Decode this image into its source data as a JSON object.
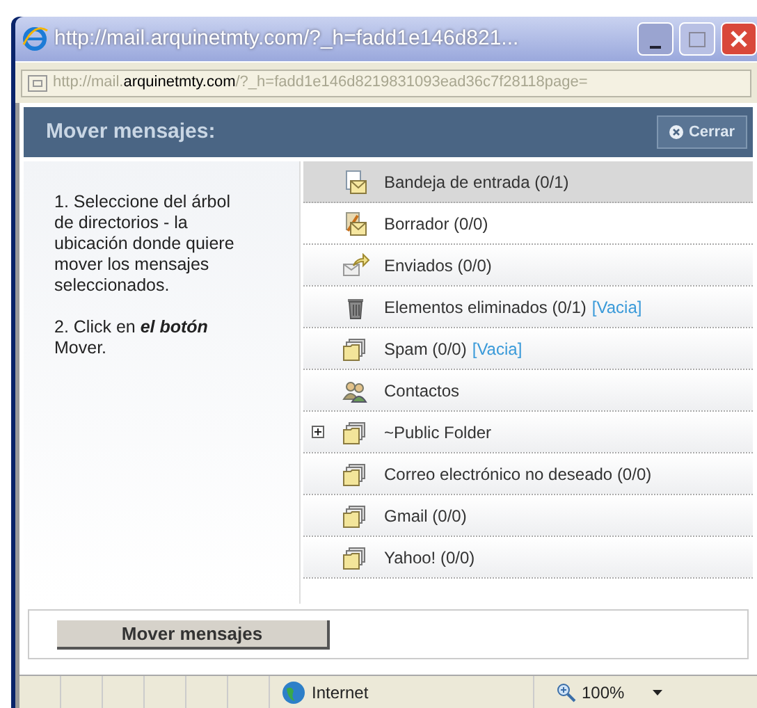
{
  "window": {
    "title": "http://mail.arquinetmty.com/?_h=fadd1e146d821..."
  },
  "address": {
    "prefix": "http://mail.",
    "domain": "arquinetmty.com",
    "suffix": "/?_h=fadd1e146d8219831093ead36c7f28118page="
  },
  "header": {
    "title": "Mover mensajes:",
    "close": "Cerrar"
  },
  "instructions": [
    "1. Seleccione del árbol de directorios - la ubicación donde quiere mover los mensajes seleccionados.",
    "2. Click en **el botón** Mover."
  ],
  "folders": [
    {
      "kind": "inbox",
      "label": "Bandeja de entrada (0/1)",
      "selected": true
    },
    {
      "kind": "drafts",
      "label": "Borrador (0/0)",
      "selected": false
    },
    {
      "kind": "sent",
      "label": "Enviados (0/0)",
      "selected": false
    },
    {
      "kind": "trash",
      "label": "Elementos eliminados (0/1)",
      "action": "[Vacia]",
      "selected": false
    },
    {
      "kind": "folder",
      "label": "Spam (0/0)",
      "action": "[Vacia]",
      "selected": false
    },
    {
      "kind": "contacts",
      "label": "Contactos",
      "selected": false
    },
    {
      "kind": "folder",
      "label": "~Public Folder",
      "expanded": false,
      "selected": false
    },
    {
      "kind": "folder",
      "label": "Correo electrónico no deseado (0/0)",
      "selected": false
    },
    {
      "kind": "folder",
      "label": "Gmail (0/0)",
      "selected": false
    },
    {
      "kind": "folder",
      "label": "Yahoo! (0/0)",
      "selected": false
    }
  ],
  "move_button": "Mover mensajes",
  "status_bar": {
    "zone": "Internet",
    "zoom": "100%"
  }
}
